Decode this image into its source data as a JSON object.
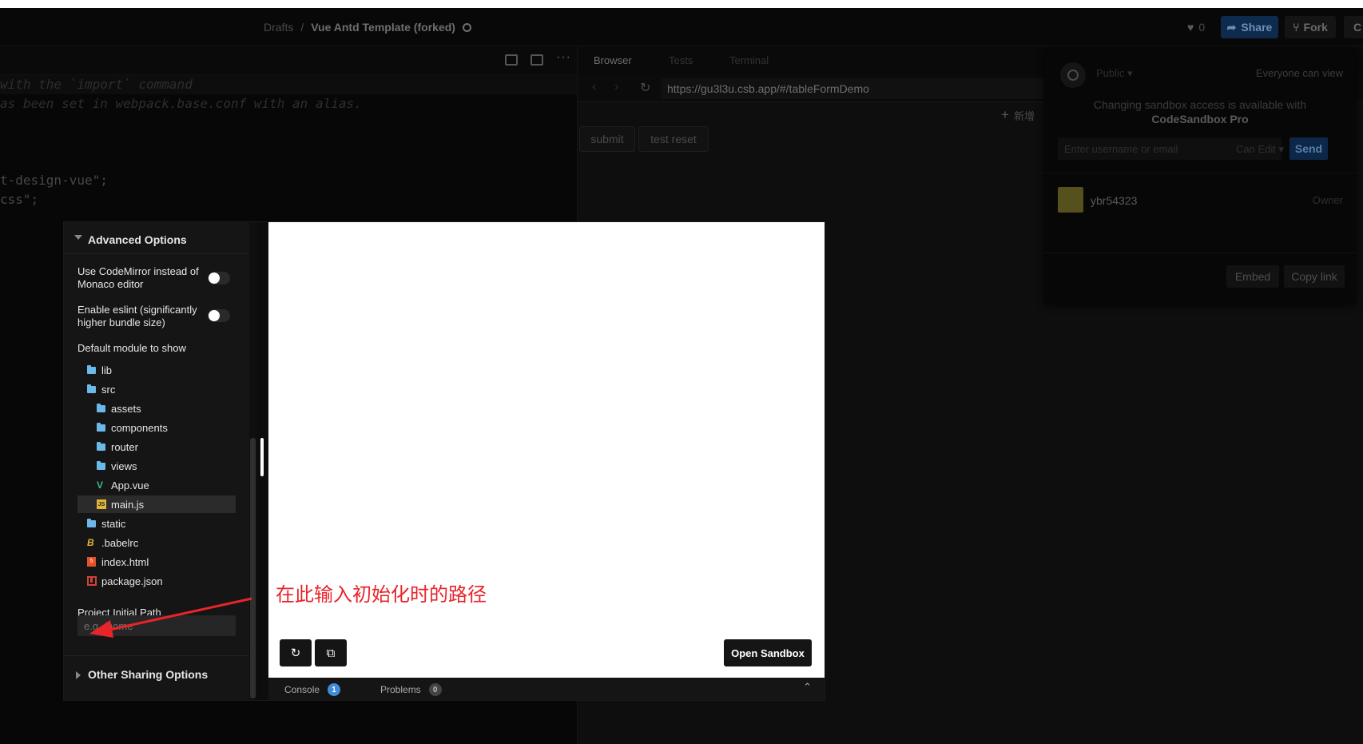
{
  "header": {
    "breadcrumb_root": "Drafts",
    "breadcrumb_sep": "/",
    "sandbox_title": "Vue Antd Template (forked)",
    "likes": "0",
    "share_label": "Share",
    "fork_label": "Fork",
    "cut_label": "C"
  },
  "editor": {
    "lines": [
      "with the `import` command",
      "as been set in webpack.base.conf with an alias.",
      "t-design-vue\";",
      "css\";"
    ]
  },
  "browser": {
    "tabs": [
      "Browser",
      "Tests",
      "Terminal"
    ],
    "url": "https://gu3l3u.csb.app/#/tableFormDemo",
    "add_label": "新增",
    "buttons": [
      "submit",
      "test reset"
    ]
  },
  "share_popover": {
    "visibility": "Public",
    "visibility_desc": "Everyone can view",
    "message_prefix": "Changing sandbox access is available with",
    "message_pro": "CodeSandbox Pro",
    "invite_placeholder": "Enter username or email",
    "permission": "Can Edit",
    "send_label": "Send",
    "user_name": "ybr54323",
    "user_role": "Owner",
    "embed_label": "Embed",
    "copy_link_label": "Copy link"
  },
  "embed_modal": {
    "advanced_title": "Advanced Options",
    "option_codemirror": "Use CodeMirror instead of Monaco editor",
    "option_eslint": "Enable eslint (significantly higher bundle size)",
    "default_module_label": "Default module to show",
    "tree": [
      {
        "name": "lib",
        "type": "folder",
        "depth": 0
      },
      {
        "name": "src",
        "type": "folder",
        "depth": 0
      },
      {
        "name": "assets",
        "type": "folder",
        "depth": 1
      },
      {
        "name": "components",
        "type": "folder",
        "depth": 1
      },
      {
        "name": "router",
        "type": "folder",
        "depth": 1
      },
      {
        "name": "views",
        "type": "folder",
        "depth": 1
      },
      {
        "name": "App.vue",
        "type": "vue",
        "depth": 1
      },
      {
        "name": "main.js",
        "type": "js",
        "depth": 1,
        "selected": true
      },
      {
        "name": "static",
        "type": "folder",
        "depth": 0
      },
      {
        "name": ".babelrc",
        "type": "babel",
        "depth": 0
      },
      {
        "name": "index.html",
        "type": "html",
        "depth": 0
      },
      {
        "name": "package.json",
        "type": "npm",
        "depth": 0
      }
    ],
    "initial_path_label": "Project Initial Path",
    "initial_path_placeholder": "e.g. /home",
    "other_options_title": "Other Sharing Options",
    "open_sandbox_label": "Open Sandbox",
    "console_label": "Console",
    "console_count": "1",
    "problems_label": "Problems",
    "problems_count": "0"
  },
  "annotation": {
    "text": "在此输入初始化时的路径",
    "color": "#e8242b"
  },
  "colors": {
    "share_button": "#0e2a4c",
    "send_button": "#0c2748",
    "folder_icon": "#6cb8e8",
    "vue_icon": "#42b883",
    "console_badge": "#3f8ed6"
  }
}
